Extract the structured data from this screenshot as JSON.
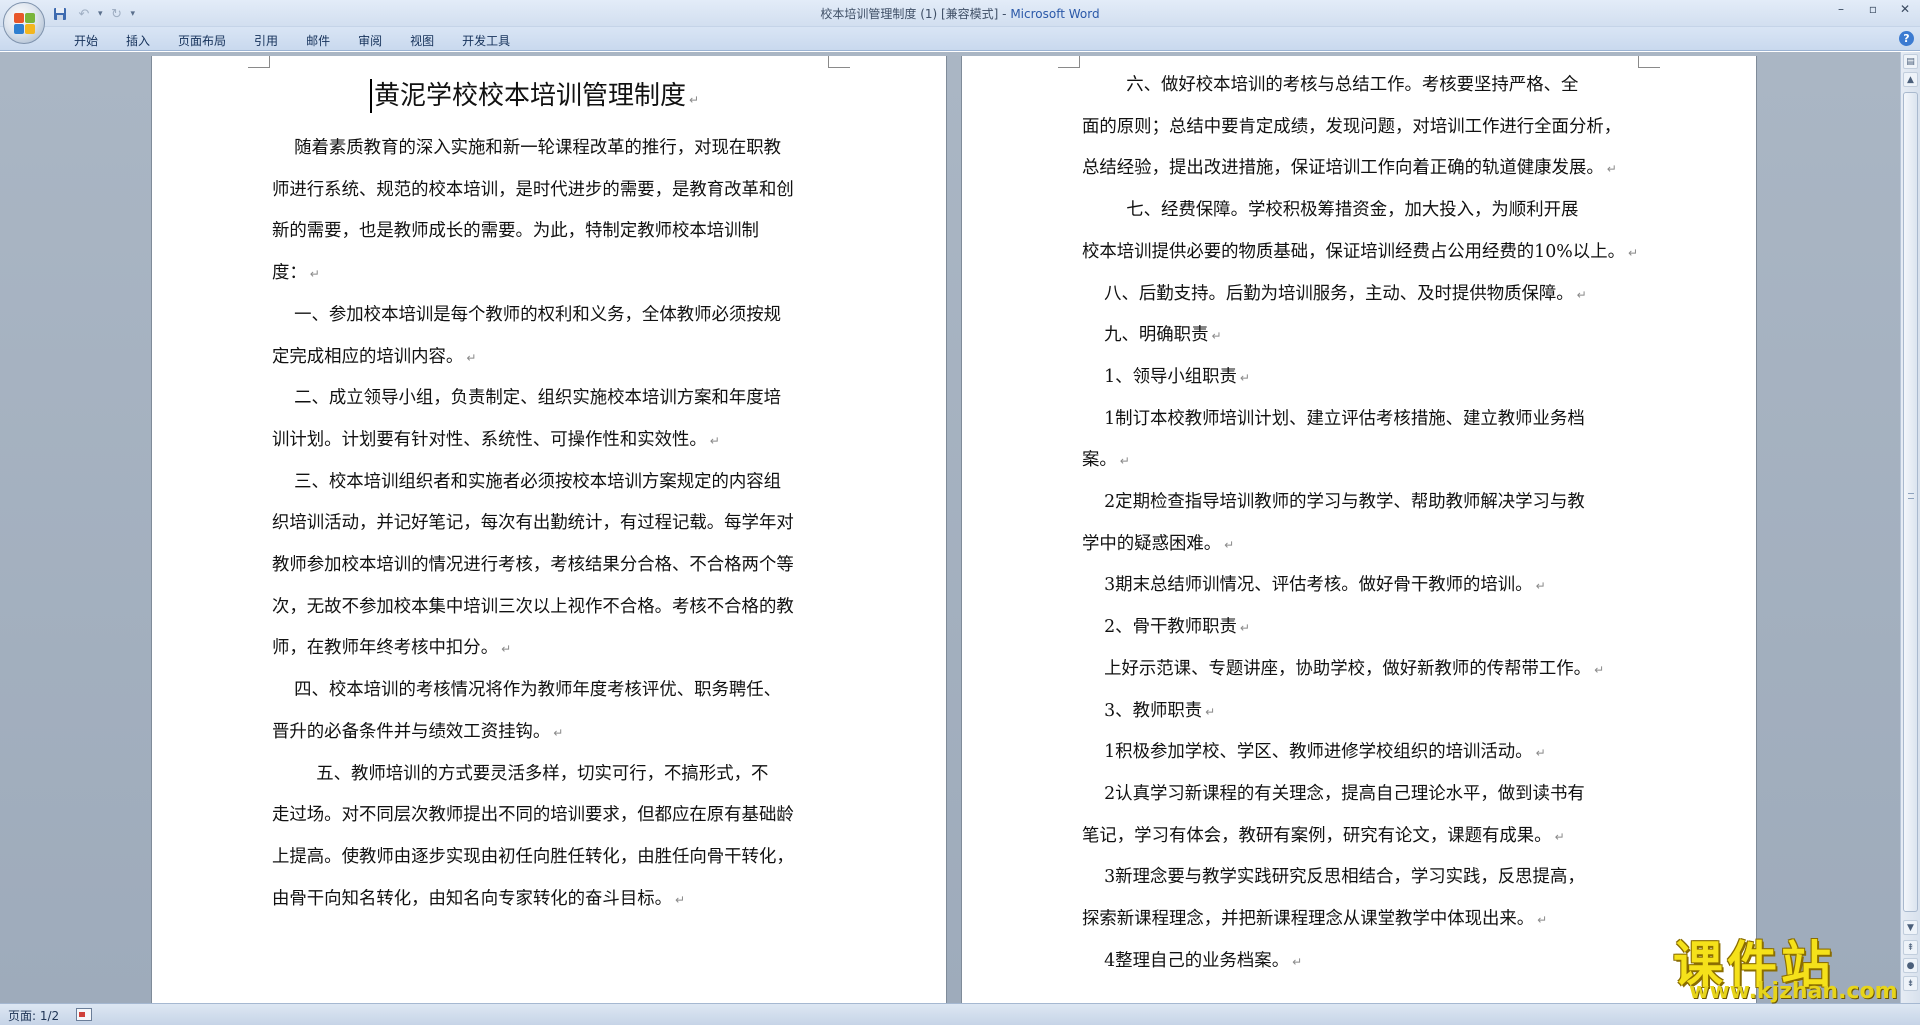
{
  "window": {
    "title_doc": "校本培训管理制度 (1) [兼容模式] - ",
    "title_app": "Microsoft Word"
  },
  "ribbon": {
    "tabs": [
      "开始",
      "插入",
      "页面布局",
      "引用",
      "邮件",
      "审阅",
      "视图",
      "开发工具"
    ]
  },
  "icons": {
    "office_button": "office-logo-icon",
    "save": "save-icon",
    "undo": "undo-icon",
    "redo": "redo-icon",
    "help": "help-icon"
  },
  "document": {
    "title": "黄泥学校校本培训管理制度",
    "left_lines": [
      "    随着素质教育的深入实施和新一轮课程改革的推行，对现在职教",
      "师进行系统、规范的校本培训，是时代进步的需要，是教育改革和创",
      "新的需要，也是教师成长的需要。为此，特制定教师校本培训制",
      "度：",
      "    一、参加校本培训是每个教师的权利和义务，全体教师必须按规",
      "定完成相应的培训内容。",
      "    二、成立领导小组，负责制定、组织实施校本培训方案和年度培",
      "训计划。计划要有针对性、系统性、可操作性和实效性。",
      "    三、校本培训组织者和实施者必须按校本培训方案规定的内容组",
      "织培训活动，并记好笔记，每次有出勤统计，有过程记载。每学年对",
      "教师参加校本培训的情况进行考核，考核结果分合格、不合格两个等",
      "次，无故不参加校本集中培训三次以上视作不合格。考核不合格的教",
      "师，在教师年终考核中扣分。",
      "    四、校本培训的考核情况将作为教师年度考核评优、职务聘任、",
      "晋升的必备条件并与绩效工资挂钩。",
      "        五、教师培训的方式要灵活多样，切实可行，不搞形式，不",
      "走过场。对不同层次教师提出不同的培训要求，但都应在原有基础龄",
      "上提高。使教师由逐步实现由初任向胜任转化，由胜任向骨干转化，",
      "由骨干向知名转化，由知名向专家转化的奋斗目标。"
    ],
    "right_lines": [
      "        六、做好校本培训的考核与总结工作。考核要坚持严格、全",
      "面的原则；总结中要肯定成绩，发现问题，对培训工作进行全面分析，",
      "总结经验，提出改进措施，保证培训工作向着正确的轨道健康发展。",
      "        七、经费保障。学校积极筹措资金，加大投入，为顺利开展",
      "校本培训提供必要的物质基础，保证培训经费占公用经费的10%以上。",
      "    八、后勤支持。后勤为培训服务，主动、及时提供物质保障。",
      "    九、明确职责",
      "    1、领导小组职责",
      "    1制订本校教师培训计划、建立评估考核措施、建立教师业务档",
      "案。",
      "    2定期检查指导培训教师的学习与教学、帮助教师解决学习与教",
      "学中的疑惑困难。",
      "    3期末总结师训情况、评估考核。做好骨干教师的培训。",
      "    2、骨干教师职责",
      "    上好示范课、专题讲座，协助学校，做好新教师的传帮带工作。",
      "    3、教师职责",
      "    1积极参加学校、学区、教师进修学校组织的培训活动。",
      "    2认真学习新课程的有关理念，提高自己理论水平，做到读书有",
      "笔记，学习有体会，教研有案例，研究有论文，课题有成果。",
      "    3新理念要与教学实践研究反思相结合，学习实践，反思提高，",
      "探索新课程理念，并把新课程理念从课堂教学中体现出来。",
      "    4整理自己的业务档案。"
    ],
    "left_para_end": [
      3,
      5,
      7,
      12,
      14,
      18
    ],
    "right_para_end": [
      2,
      4,
      5,
      6,
      7,
      9,
      11,
      12,
      13,
      14,
      15,
      16,
      18,
      20,
      21
    ]
  },
  "status": {
    "page": "页面: 1/2"
  },
  "watermark": {
    "big": "课件站",
    "url": "www.kjzhan.com"
  }
}
